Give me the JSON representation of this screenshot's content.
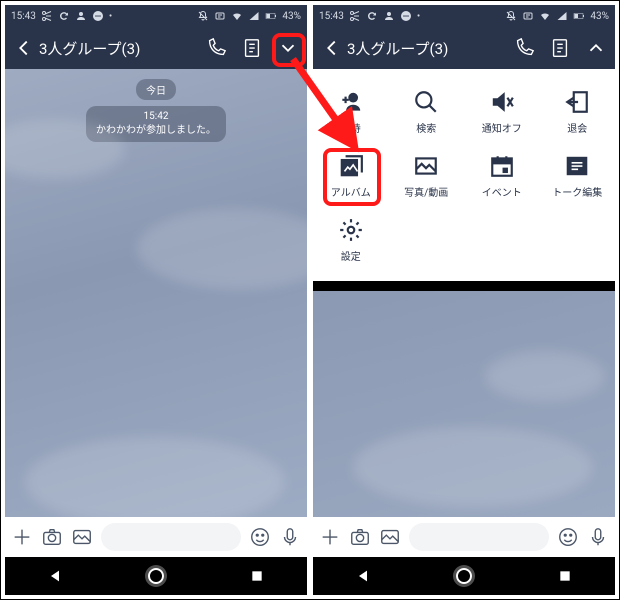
{
  "status": {
    "time": "15:43",
    "battery": "43%"
  },
  "header": {
    "title": "3人グループ(3)"
  },
  "chat": {
    "date": "今日",
    "sys_time": "15:42",
    "sys_text": "かわかわが参加しました。"
  },
  "menu": {
    "items": [
      {
        "label": "招待"
      },
      {
        "label": "検索"
      },
      {
        "label": "通知オフ"
      },
      {
        "label": "退会"
      },
      {
        "label": "アルバム"
      },
      {
        "label": "写真/動画"
      },
      {
        "label": "イベント"
      },
      {
        "label": "トーク編集"
      },
      {
        "label": "設定"
      }
    ]
  }
}
